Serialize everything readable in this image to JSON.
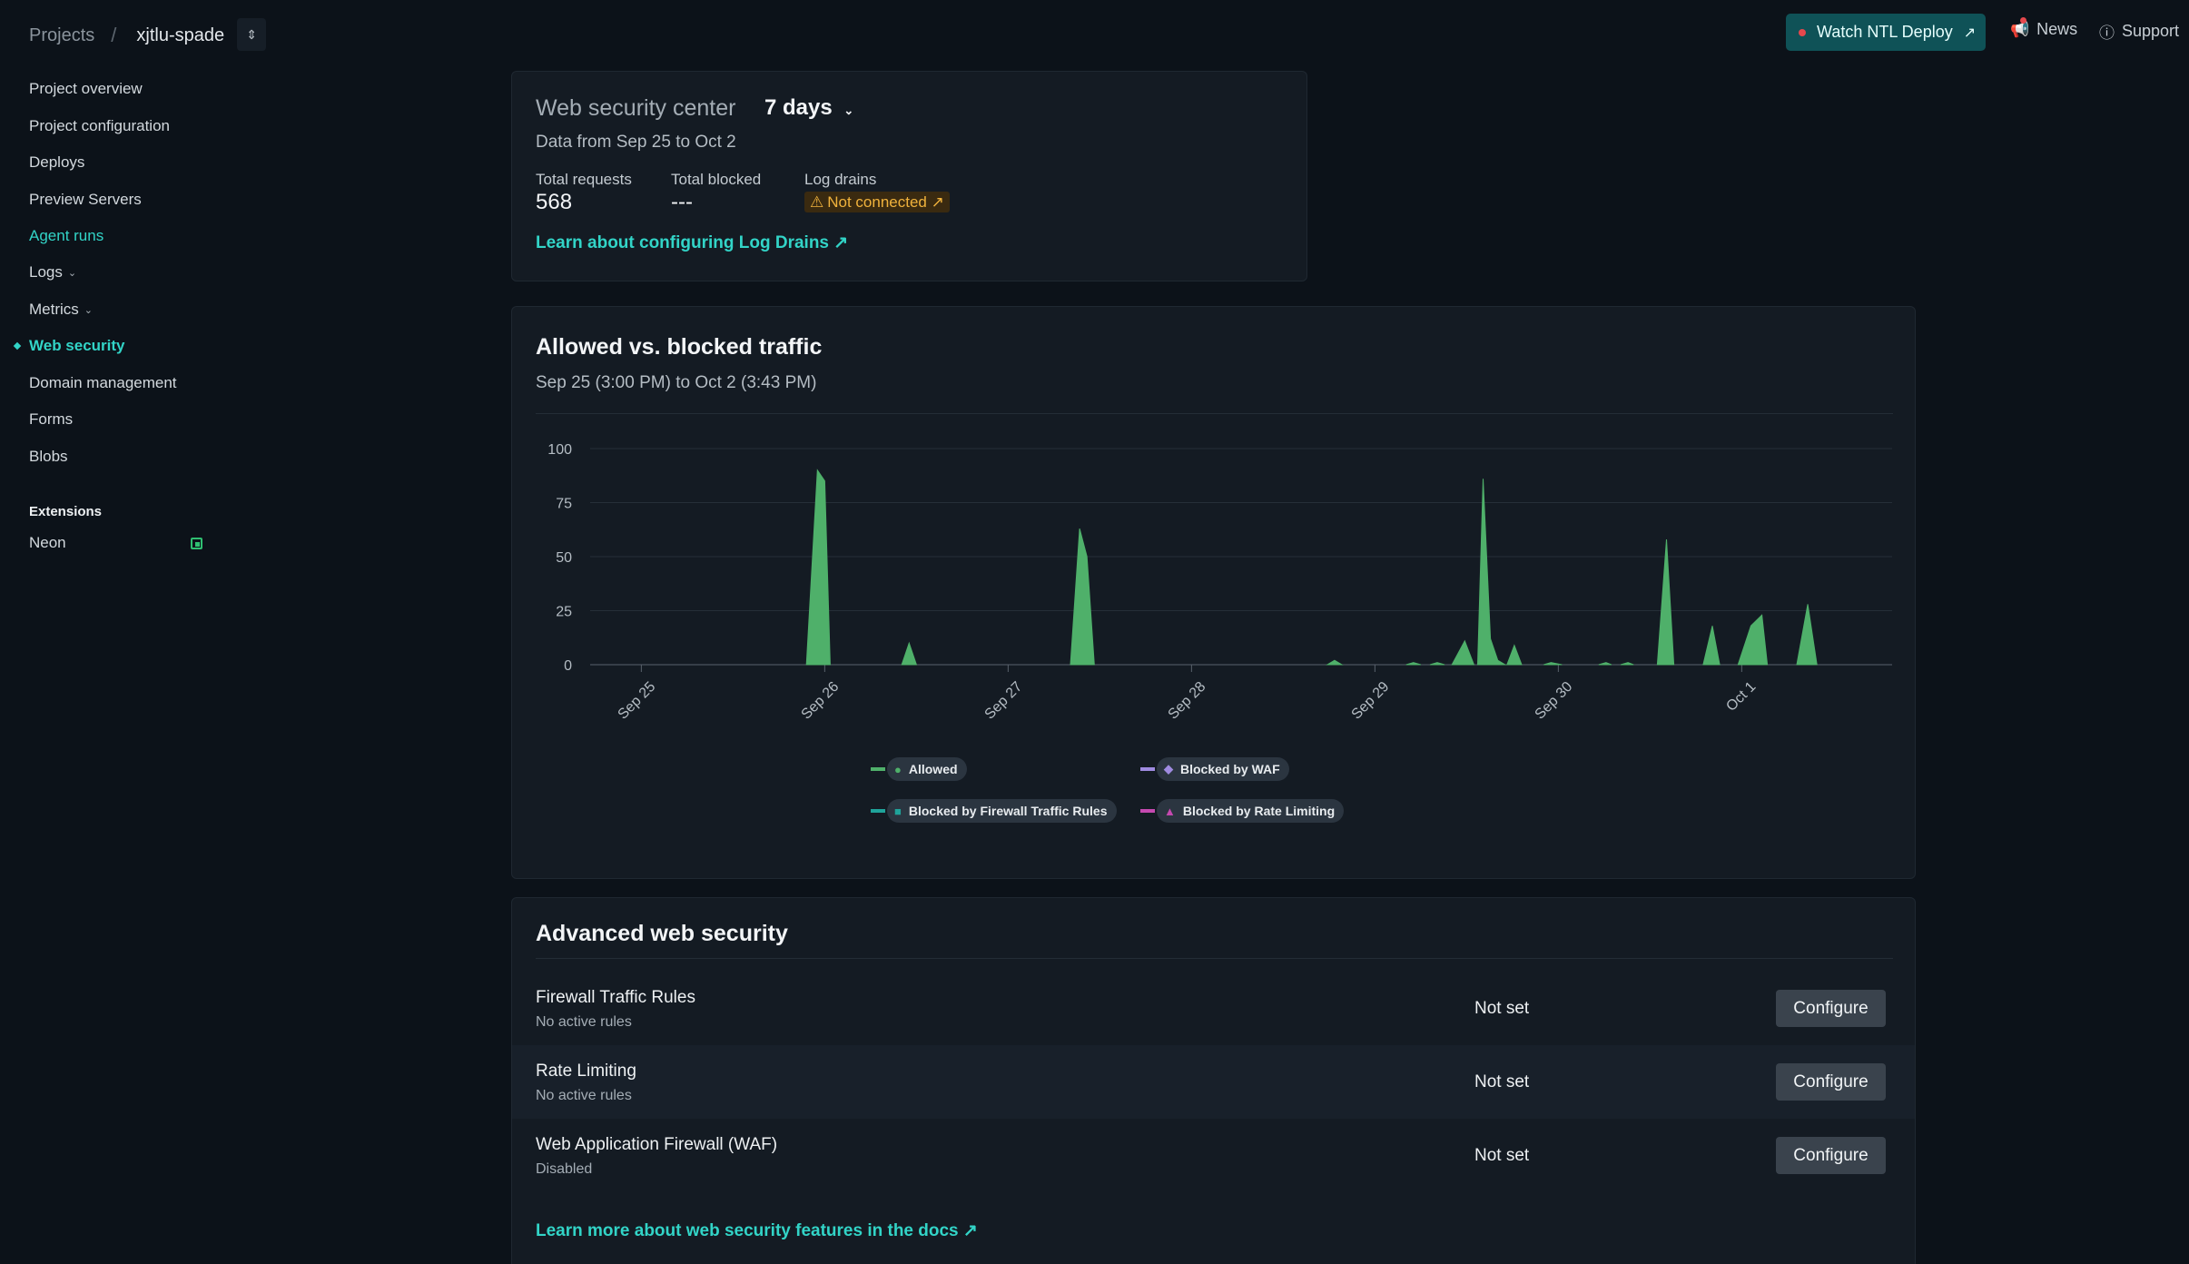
{
  "header": {
    "projects_label": "Projects",
    "separator": "/",
    "site_name": "xjtlu-spade",
    "watch_label": "Watch NTL Deploy",
    "news_label": "News",
    "support_label": "Support"
  },
  "sidebar": {
    "items": [
      {
        "label": "Project overview"
      },
      {
        "label": "Project configuration"
      },
      {
        "label": "Deploys"
      },
      {
        "label": "Preview Servers"
      },
      {
        "label": "Agent runs"
      },
      {
        "label": "Logs"
      },
      {
        "label": "Metrics"
      },
      {
        "label": "Web security"
      },
      {
        "label": "Domain management"
      },
      {
        "label": "Forms"
      },
      {
        "label": "Blobs"
      }
    ],
    "extensions_heading": "Extensions",
    "extensions": [
      {
        "label": "Neon"
      }
    ]
  },
  "security_center": {
    "title": "Web security center",
    "range": "7 days",
    "subtitle": "Data from Sep 25 to Oct 2",
    "total_requests_label": "Total requests",
    "total_requests": "568",
    "total_blocked_label": "Total blocked",
    "total_blocked": "---",
    "log_drains_label": "Log drains",
    "log_drains_status": "Not connected ↗",
    "learn_link": "Learn about configuring Log Drains ↗"
  },
  "traffic": {
    "title": "Allowed vs. blocked traffic",
    "subtitle": "Sep 25 (3:00 PM) to Oct 2 (3:43 PM)"
  },
  "chart_data": {
    "type": "area",
    "x_labels": [
      "Sep 25",
      "Sep 26",
      "Sep 27",
      "Sep 28",
      "Sep 29",
      "Sep 30",
      "Oct 1"
    ],
    "ylim": [
      0,
      100
    ],
    "y_ticks": [
      100,
      75,
      50,
      25,
      0
    ],
    "grid": true,
    "legend": [
      "Allowed",
      "Blocked by WAF",
      "Blocked by Firewall Traffic Rules",
      "Blocked by Rate Limiting"
    ],
    "colors": {
      "Allowed": "#4fb06a",
      "Blocked by WAF": "#9f8be0",
      "Blocked by Firewall Traffic Rules": "#1fa39a",
      "Blocked by Rate Limiting": "#c549b0"
    },
    "series": [
      {
        "name": "Allowed",
        "points": [
          [
            1.78,
            0
          ],
          [
            1.84,
            90
          ],
          [
            1.88,
            85
          ],
          [
            1.91,
            0
          ],
          [
            2.3,
            0
          ],
          [
            2.34,
            10
          ],
          [
            2.38,
            0
          ],
          [
            3.22,
            0
          ],
          [
            3.27,
            63
          ],
          [
            3.31,
            50
          ],
          [
            3.35,
            0
          ],
          [
            4.62,
            0
          ],
          [
            4.66,
            2
          ],
          [
            4.7,
            0
          ],
          [
            5.05,
            0
          ],
          [
            5.09,
            1
          ],
          [
            5.13,
            0
          ],
          [
            5.18,
            0
          ],
          [
            5.22,
            1
          ],
          [
            5.26,
            0
          ],
          [
            5.3,
            0
          ],
          [
            5.37,
            11
          ],
          [
            5.42,
            0
          ],
          [
            5.44,
            0
          ],
          [
            5.47,
            86
          ],
          [
            5.51,
            12
          ],
          [
            5.55,
            2
          ],
          [
            5.59,
            0
          ],
          [
            5.6,
            0
          ],
          [
            5.64,
            9
          ],
          [
            5.68,
            0
          ],
          [
            5.8,
            0
          ],
          [
            5.84,
            1
          ],
          [
            5.9,
            0
          ],
          [
            6.1,
            0
          ],
          [
            6.14,
            1
          ],
          [
            6.17,
            0
          ],
          [
            6.22,
            0
          ],
          [
            6.26,
            1
          ],
          [
            6.29,
            0
          ],
          [
            6.42,
            0
          ],
          [
            6.47,
            58
          ],
          [
            6.51,
            0
          ],
          [
            6.67,
            0
          ],
          [
            6.72,
            18
          ],
          [
            6.76,
            0
          ],
          [
            6.86,
            0
          ],
          [
            6.93,
            18
          ],
          [
            6.99,
            23
          ],
          [
            7.02,
            0
          ],
          [
            7.18,
            0
          ],
          [
            7.24,
            28
          ],
          [
            7.29,
            0
          ]
        ]
      }
    ]
  },
  "advanced": {
    "title": "Advanced web security",
    "rows": [
      {
        "name": "Firewall Traffic Rules",
        "desc": "No active rules",
        "status": "Not set",
        "button": "Configure"
      },
      {
        "name": "Rate Limiting",
        "desc": "No active rules",
        "status": "Not set",
        "button": "Configure"
      },
      {
        "name": "Web Application Firewall (WAF)",
        "desc": "Disabled",
        "status": "Not set",
        "button": "Configure"
      }
    ],
    "docs_link": "Learn more about web security features in the docs ↗"
  }
}
